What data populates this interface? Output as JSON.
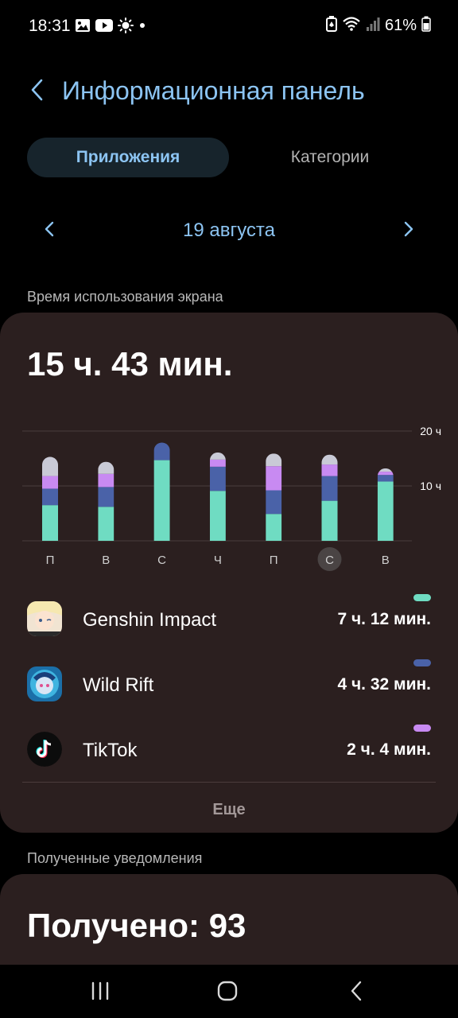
{
  "status_bar": {
    "time": "18:31",
    "battery_pct": "61%",
    "icons_left": [
      "gallery-icon",
      "youtube-icon",
      "brightness-icon",
      "dot-icon"
    ],
    "icons_right": [
      "battery-saver-icon",
      "wifi-icon",
      "signal-icon",
      "battery-icon"
    ]
  },
  "header": {
    "title": "Информационная панель",
    "back_icon": "chevron-left-icon"
  },
  "tabs": [
    {
      "label": "Приложения",
      "active": true
    },
    {
      "label": "Категории",
      "active": false
    }
  ],
  "date_nav": {
    "label": "19 августа",
    "prev_icon": "chevron-left-icon",
    "next_icon": "chevron-right-icon"
  },
  "screen_time": {
    "section_label": "Время использования экрана",
    "total": "15 ч. 43 мин."
  },
  "chart_data": {
    "type": "bar",
    "stacked": true,
    "categories": [
      "П",
      "В",
      "С",
      "Ч",
      "П",
      "С",
      "В"
    ],
    "selected_index": 5,
    "y_ticks": [
      {
        "value": 10,
        "label": "10 ч"
      },
      {
        "value": 20,
        "label": "20 ч"
      }
    ],
    "ylim": [
      0,
      20
    ],
    "series": [
      {
        "name": "Genshin Impact",
        "color": "#6fdcc2",
        "values": [
          6.5,
          6.2,
          14.7,
          9.1,
          4.9,
          7.3,
          10.8
        ]
      },
      {
        "name": "Wild Rift",
        "color": "#4a62a8",
        "values": [
          3.0,
          3.6,
          3.2,
          4.4,
          4.3,
          4.5,
          1.2
        ]
      },
      {
        "name": "TikTok",
        "color": "#c88af2",
        "values": [
          2.3,
          2.4,
          0.0,
          1.3,
          4.4,
          2.1,
          0.6
        ]
      },
      {
        "name": "other",
        "color": "#c9cad6",
        "values": [
          3.5,
          2.2,
          0.0,
          1.3,
          2.3,
          1.8,
          0.6
        ]
      }
    ]
  },
  "apps": [
    {
      "name": "Genshin Impact",
      "time": "7 ч. 12 мин.",
      "color": "#6fdcc2",
      "icon": "genshin-icon"
    },
    {
      "name": "Wild Rift",
      "time": "4 ч. 32 мин.",
      "color": "#4a62a8",
      "icon": "wild-rift-icon"
    },
    {
      "name": "TikTok",
      "time": "2 ч. 4 мин.",
      "color": "#c88af2",
      "icon": "tiktok-icon"
    }
  ],
  "more_label": "Еще",
  "notifications": {
    "section_label": "Полученные уведомления",
    "received": "Получено: 93"
  },
  "navbar": {
    "icons": [
      "recent-apps-icon",
      "home-icon",
      "back-icon"
    ]
  }
}
